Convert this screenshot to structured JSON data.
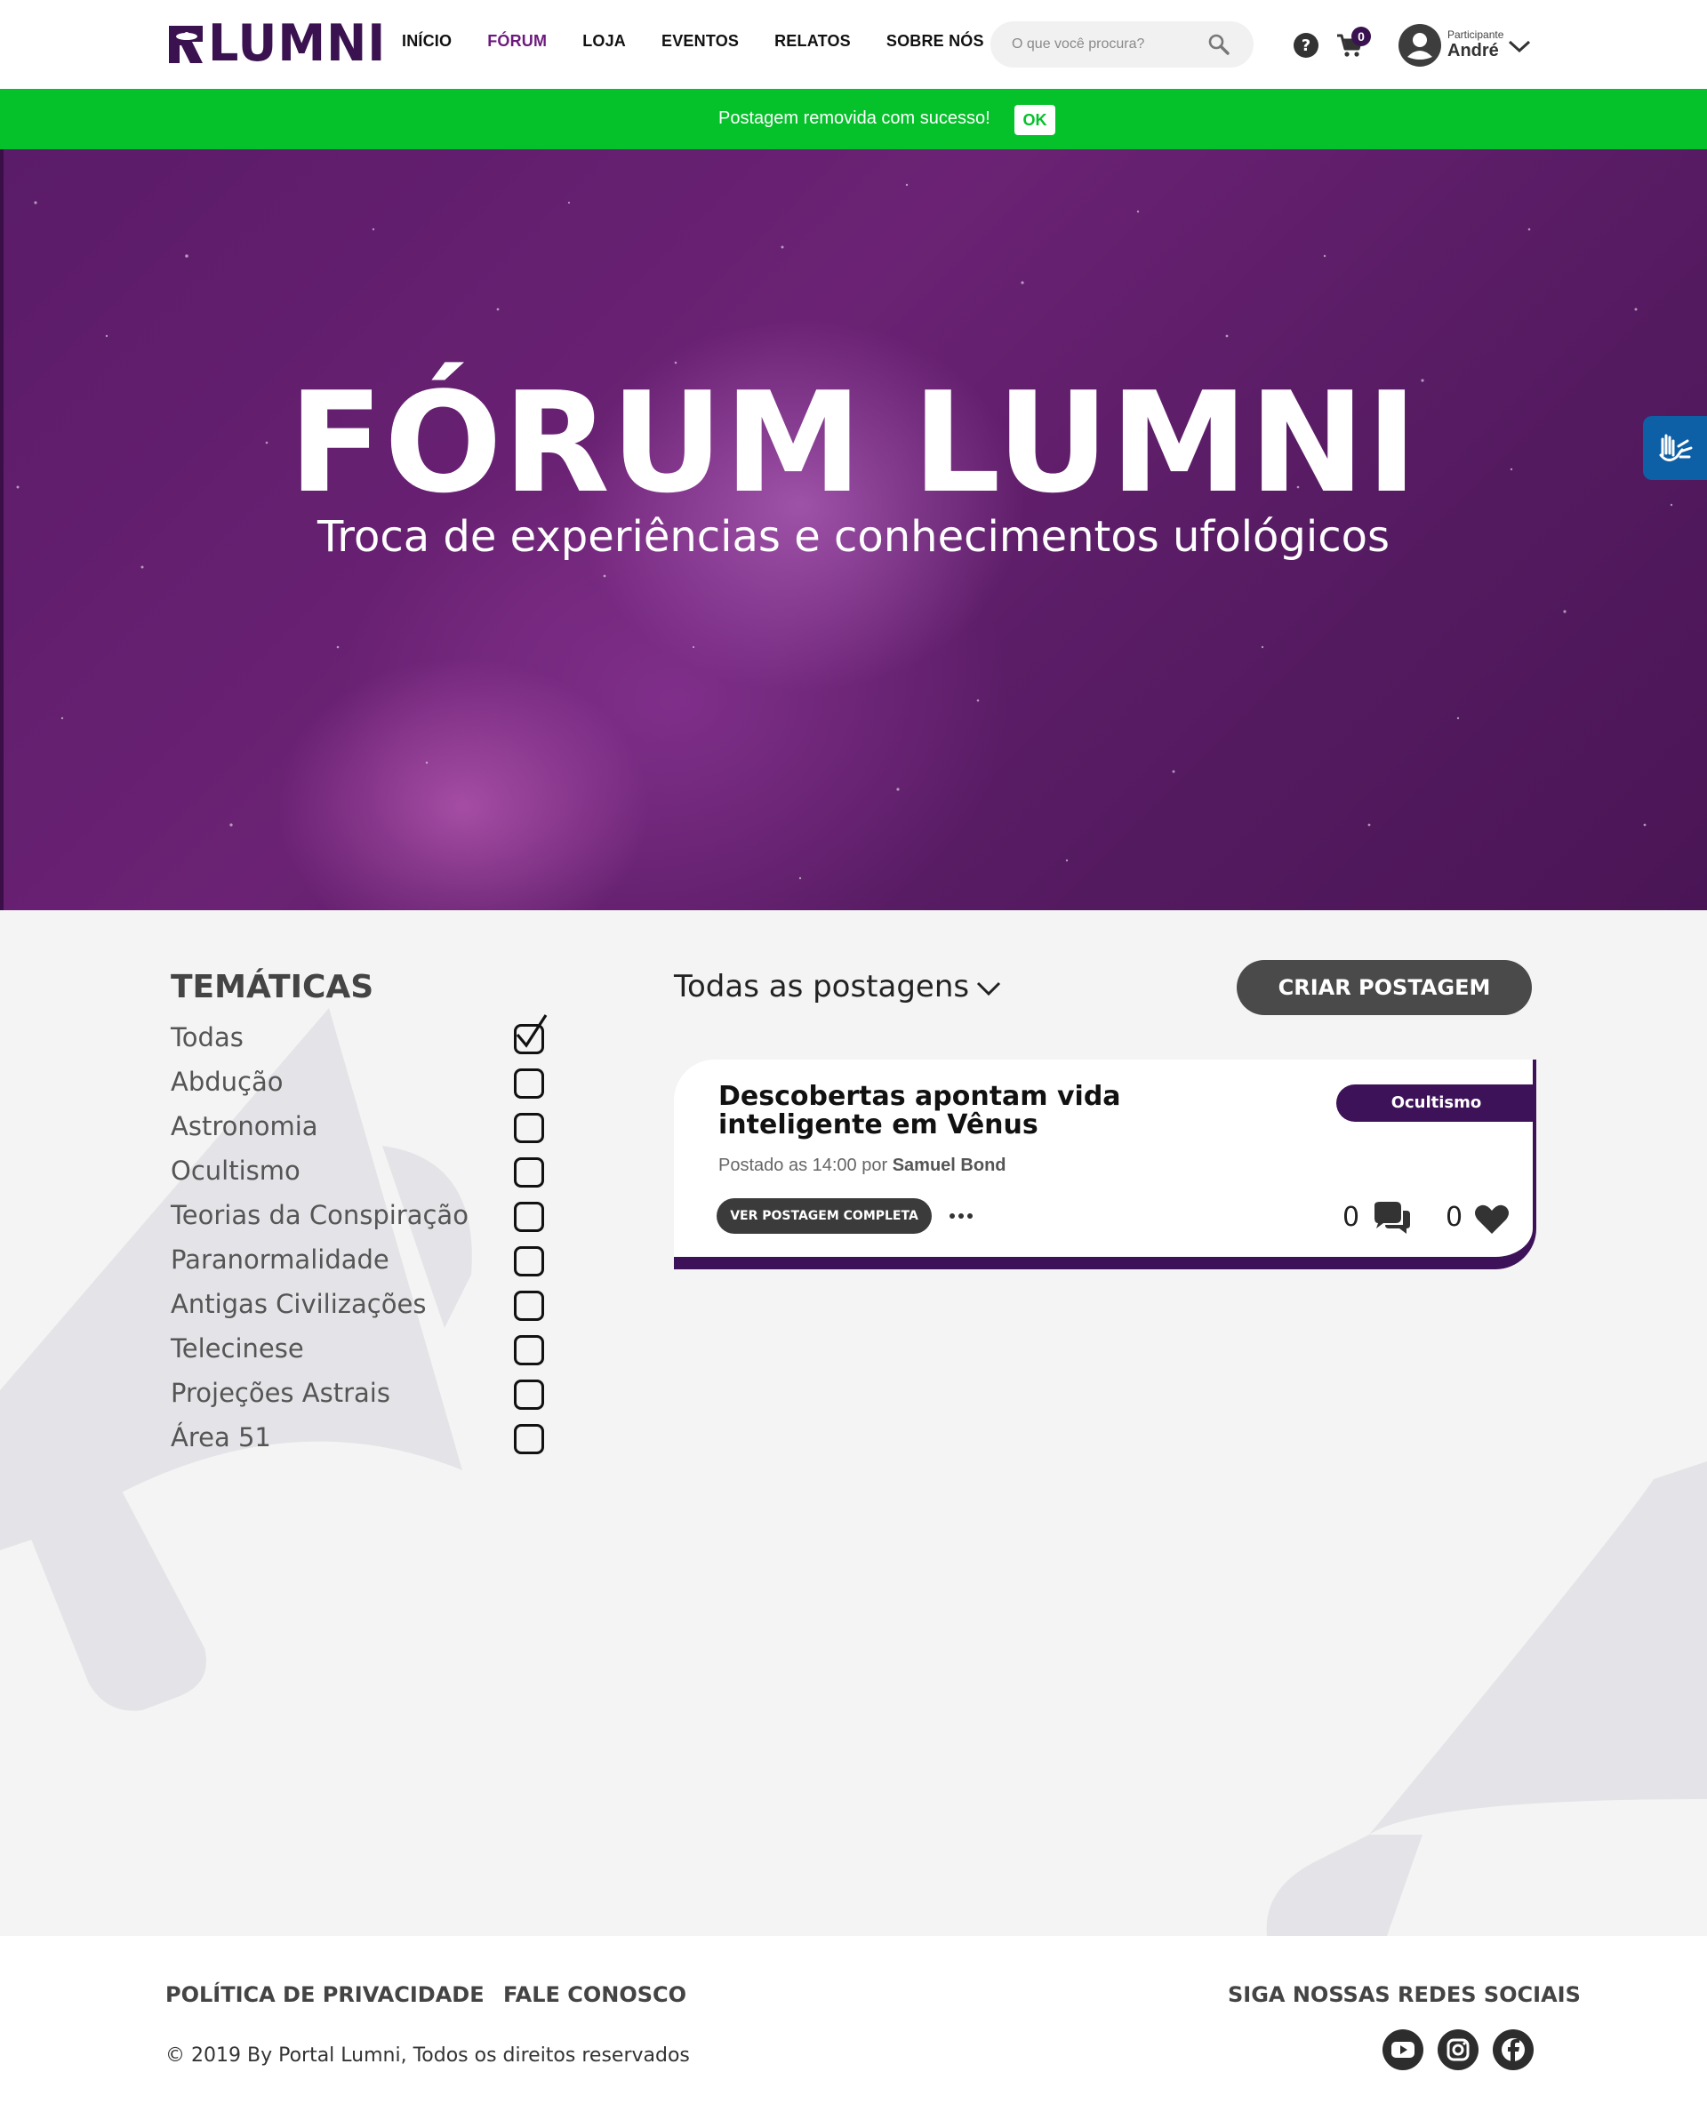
{
  "header": {
    "logo_text": "LUMNI",
    "nav": [
      "INÍCIO",
      "FÓRUM",
      "LOJA",
      "EVENTOS",
      "RELATOS",
      "SOBRE NÓS"
    ],
    "active_nav": "FÓRUM",
    "search_placeholder": "O que você procura?",
    "cart_count": "0",
    "user_role": "Participante",
    "user_name": "André"
  },
  "toast": {
    "message": "Postagem removida com sucesso!",
    "ok_label": "OK"
  },
  "hero": {
    "title": "FÓRUM LUMNI",
    "subtitle": "Troca de experiências e conhecimentos ufológicos"
  },
  "topics": {
    "title": "TEMÁTICAS",
    "items": [
      {
        "label": "Todas",
        "checked": true
      },
      {
        "label": "Abdução",
        "checked": false
      },
      {
        "label": "Astronomia",
        "checked": false
      },
      {
        "label": "Ocultismo",
        "checked": false
      },
      {
        "label": "Teorias da Conspiração",
        "checked": false
      },
      {
        "label": "Paranormalidade",
        "checked": false
      },
      {
        "label": "Antigas Civilizações",
        "checked": false
      },
      {
        "label": "Telecinese",
        "checked": false
      },
      {
        "label": "Projeções Astrais",
        "checked": false
      },
      {
        "label": "Área 51",
        "checked": false
      }
    ]
  },
  "posts": {
    "heading": "Todas as postagens",
    "create_label": "CRIAR POSTAGEM",
    "items": [
      {
        "title": "Descobertas apontam vida inteligente em Vênus",
        "meta_prefix": "Postado as 14:00 por",
        "author": "Samuel Bond",
        "tag": "Ocultismo",
        "see_label": "VER POSTAGEM COMPLETA",
        "comments": "0",
        "likes": "0"
      }
    ]
  },
  "footer": {
    "privacy": "POLÍTICA DE PRIVACIDADE",
    "contact": "FALE CONOSCO",
    "social_heading": "SIGA NOSSAS REDES SOCIAIS",
    "copyright": "© 2019 By Portal Lumni, Todos os direitos reservados",
    "social": [
      "youtube-icon",
      "instagram-icon",
      "facebook-icon"
    ]
  },
  "colors": {
    "brand": "#3b1250",
    "toast": "#05c12a",
    "accessibility": "#0d5fa6"
  }
}
